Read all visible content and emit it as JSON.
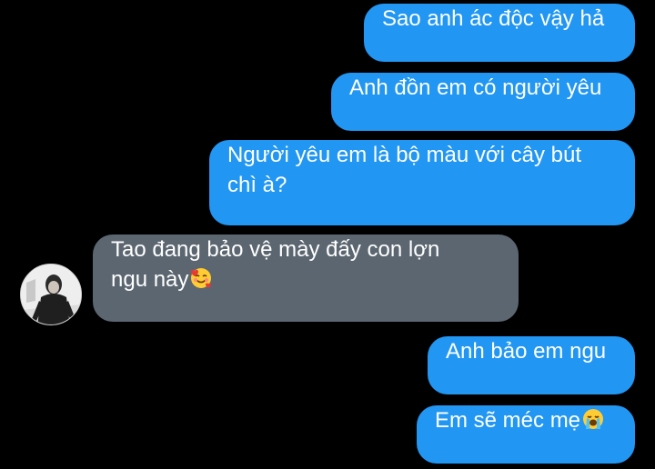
{
  "messages": [
    {
      "side": "sent",
      "text": "Sao anh ác độc vậy hả"
    },
    {
      "side": "sent",
      "text": "Anh đồn em có người yêu"
    },
    {
      "side": "sent",
      "line1": "Người yêu em là bộ màu với cây bút",
      "line2": "chì à?"
    },
    {
      "side": "received",
      "line1": "Tao đang bảo vệ mày đấy con lợn",
      "line2": "ngu này",
      "emoji": "smiling-face-with-hearts"
    },
    {
      "side": "sent",
      "text": "Anh bảo em ngu"
    },
    {
      "side": "sent",
      "text": "Em sẽ méc mẹ",
      "emoji": "loudly-crying-face"
    }
  ],
  "contact": {
    "avatar_icon": "user-avatar-photo"
  },
  "colors": {
    "background": "#000000",
    "sent_bubble": "#2196f3",
    "received_bubble": "#5b6670",
    "text": "#ffffff"
  }
}
